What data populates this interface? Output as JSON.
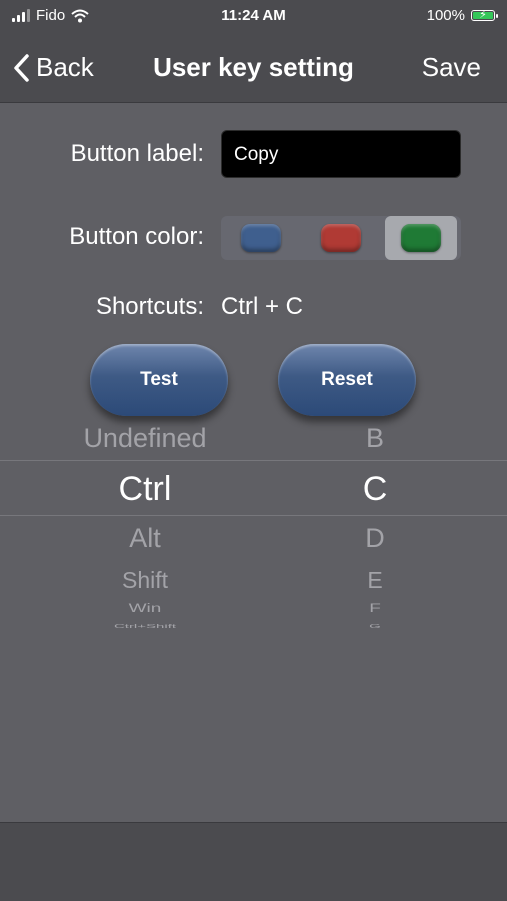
{
  "status_bar": {
    "carrier": "Fido",
    "time": "11:24 AM",
    "battery_percent": "100%"
  },
  "nav": {
    "back_label": "Back",
    "title": "User key setting",
    "save_label": "Save"
  },
  "form": {
    "button_label_caption": "Button label:",
    "button_label_value": "Copy",
    "button_color_caption": "Button color:",
    "colors": [
      {
        "name": "blue",
        "hex": "#3f5f8e",
        "selected": false
      },
      {
        "name": "red",
        "hex": "#b03a34",
        "selected": false
      },
      {
        "name": "green",
        "hex": "#1f7a35",
        "selected": true
      }
    ],
    "shortcuts_caption": "Shortcuts:",
    "shortcuts_value": "Ctrl + C"
  },
  "actions": {
    "test_label": "Test",
    "reset_label": "Reset"
  },
  "picker": {
    "modifier_column": [
      "Undefined",
      "Ctrl",
      "Alt",
      "Shift",
      "Win",
      "Ctrl+Shift"
    ],
    "key_column": [
      "B",
      "C",
      "D",
      "E",
      "F",
      "G"
    ],
    "selected_modifier": "Ctrl",
    "selected_key": "C"
  },
  "colors": {
    "background": "#5f5f64",
    "bars": "#4b4b4f",
    "battery": "#34c759"
  }
}
